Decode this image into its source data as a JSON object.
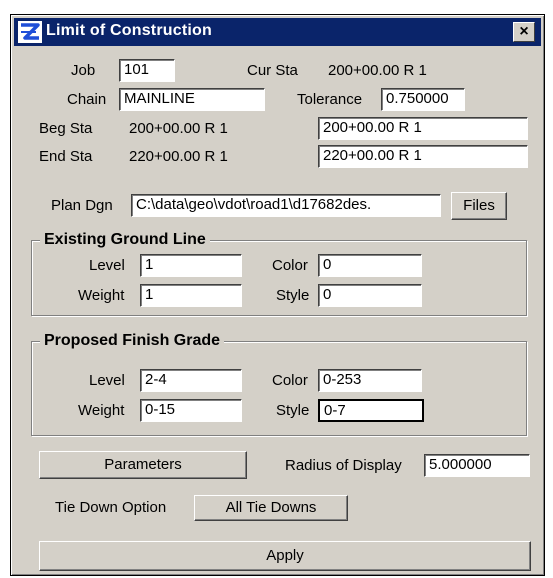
{
  "window": {
    "title": "Limit of Construction",
    "close_label": "×"
  },
  "job": {
    "label": "Job",
    "value": "101"
  },
  "cur_sta": {
    "label": "Cur Sta",
    "value": "200+00.00 R 1"
  },
  "chain": {
    "label": "Chain",
    "value": "MAINLINE"
  },
  "tolerance": {
    "label": "Tolerance",
    "value": "0.750000"
  },
  "beg_sta": {
    "label": "Beg Sta",
    "value": "200+00.00 R 1",
    "field_value": "200+00.00 R 1"
  },
  "end_sta": {
    "label": "End Sta",
    "value": "220+00.00 R 1",
    "field_value": "220+00.00 R 1"
  },
  "plan_dgn": {
    "label": "Plan Dgn",
    "value": "C:\\data\\geo\\vdot\\road1\\d17682des.",
    "files_button": "Files"
  },
  "existing_ground": {
    "title": "Existing Ground Line",
    "level_label": "Level",
    "level_value": "1",
    "color_label": "Color",
    "color_value": "0",
    "weight_label": "Weight",
    "weight_value": "1",
    "style_label": "Style",
    "style_value": "0"
  },
  "proposed_grade": {
    "title": "Proposed Finish Grade",
    "level_label": "Level",
    "level_value": "2-4",
    "color_label": "Color",
    "color_value": "0-253",
    "weight_label": "Weight",
    "weight_value": "0-15",
    "style_label": "Style",
    "style_value": "0-7"
  },
  "parameters_button": "Parameters",
  "radius": {
    "label": "Radius of Display",
    "value": "5.000000"
  },
  "tie_down": {
    "label": "Tie Down Option",
    "value": "All Tie Downs"
  },
  "apply_button": "Apply",
  "colors": {
    "titlebar": "#0a246a",
    "window_bg": "#d4d0c8",
    "icon_blue": "#1f4fd8"
  }
}
